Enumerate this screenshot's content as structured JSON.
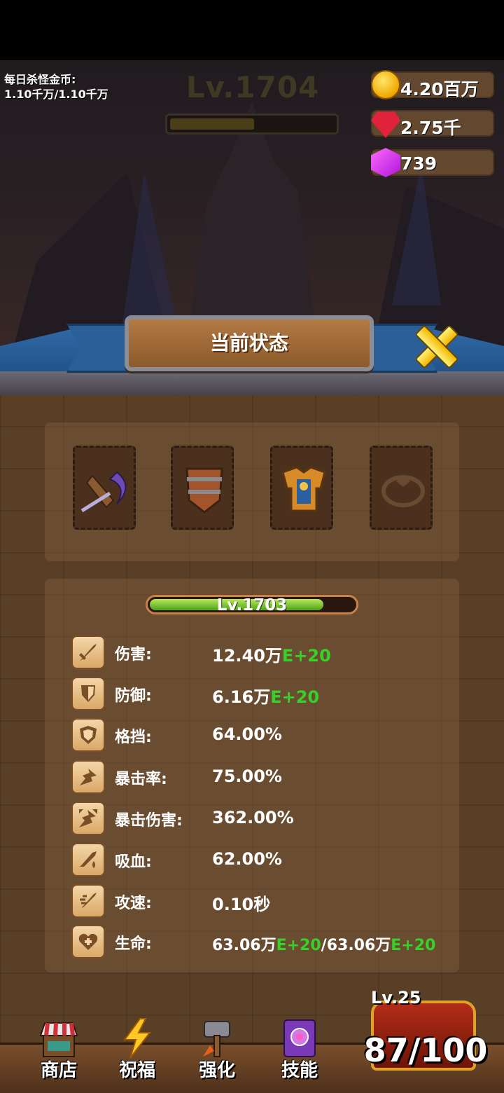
{
  "hud": {
    "daily_label": "每日杀怪金币:",
    "daily_value": "1.10千万/1.10千万",
    "level": "Lv.1704",
    "level_progress": 0.5,
    "currencies": {
      "gold": "4.20百万",
      "ruby": "2.75千",
      "gem": "739"
    }
  },
  "dialog": {
    "title": "当前状态",
    "equipment": [
      {
        "name": "scythe-icon"
      },
      {
        "name": "shield-icon"
      },
      {
        "name": "armor-icon"
      },
      {
        "name": "ring-icon"
      }
    ],
    "hero_level": "Lv.1703",
    "hero_progress": 0.85,
    "stats": [
      {
        "icon": "sword-icon",
        "label": "伤害:",
        "value": "12.40万",
        "suffix": "E+20"
      },
      {
        "icon": "defense-shield-icon",
        "label": "防御:",
        "value": "6.16万",
        "suffix": "E+20"
      },
      {
        "icon": "block-shield-icon",
        "label": "格挡:",
        "value": "64.00%",
        "suffix": ""
      },
      {
        "icon": "crit-rate-icon",
        "label": "暴击率:",
        "value": "75.00%",
        "suffix": ""
      },
      {
        "icon": "crit-damage-icon",
        "label": "暴击伤害:",
        "value": "362.00%",
        "suffix": ""
      },
      {
        "icon": "lifesteal-icon",
        "label": "吸血:",
        "value": "62.00%",
        "suffix": ""
      },
      {
        "icon": "attack-speed-icon",
        "label": "攻速:",
        "value": "0.10秒",
        "suffix": ""
      },
      {
        "icon": "life-icon",
        "label": "生命:",
        "value": "63.06万",
        "suffix": "E+20",
        "value2": "/63.06万",
        "suffix2": "E+20"
      }
    ]
  },
  "nav": {
    "shop": "商店",
    "bless": "祝福",
    "upgrade": "强化",
    "skills": "技能"
  },
  "chest": {
    "level": "Lv.25",
    "count": "87/100"
  },
  "colors": {
    "accent_green": "#37d12a",
    "panel_brown": "#5a3f27",
    "banner_blue": "#2f68a6"
  }
}
